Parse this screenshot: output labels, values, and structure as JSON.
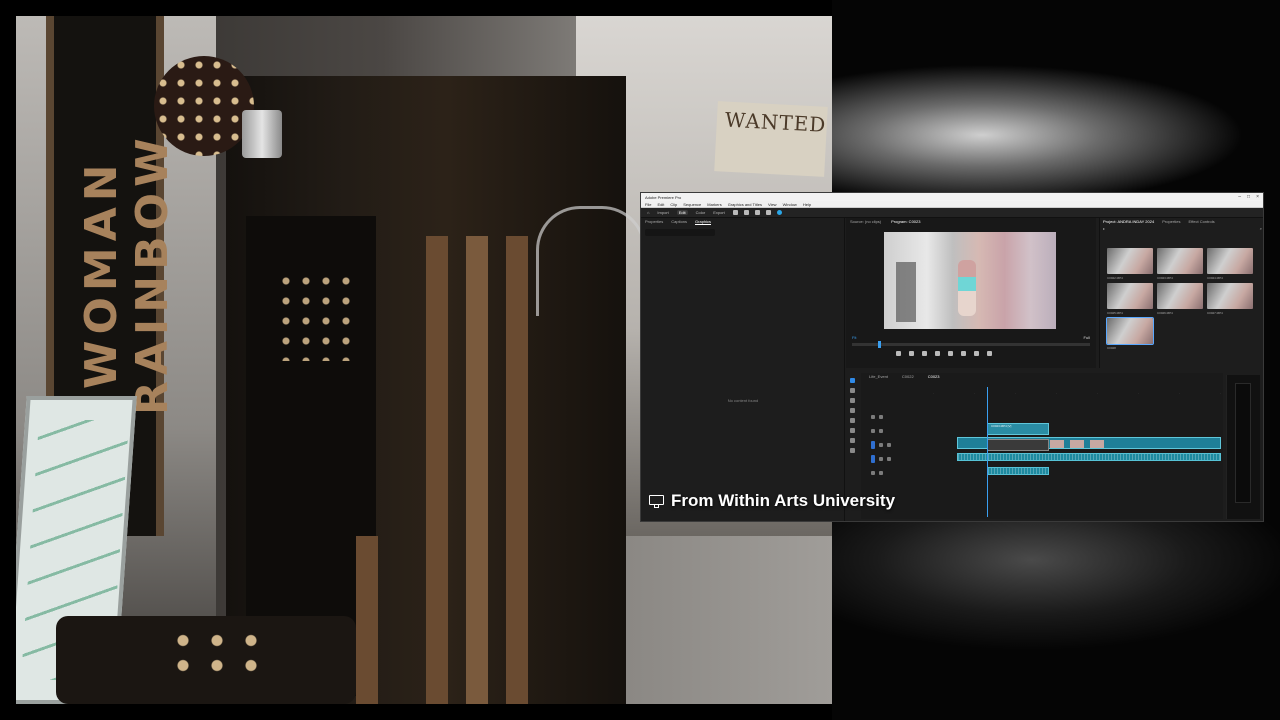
{
  "stream": {
    "caption": "From Within Arts University",
    "caption_icon": "screen-share-icon"
  },
  "background": {
    "banner_text": "WOMAN RAINBOW",
    "poster_text": "WANTED"
  },
  "premiere": {
    "window_title": "Adobe Premiere Pro",
    "menu": [
      "File",
      "Edit",
      "Clip",
      "Sequence",
      "Markers",
      "Graphics and Titles",
      "View",
      "Window",
      "Help"
    ],
    "workspaces": [
      "Import",
      "Edit",
      "Color",
      "Export"
    ],
    "active_workspace": "Edit",
    "left_panel": {
      "tabs": [
        "Properties",
        "Captions",
        "Graphics"
      ],
      "active_tab": "Graphics",
      "empty_message": "No content found"
    },
    "program_monitor": {
      "tabs": [
        "Source: (no clips)",
        "Program: C0023"
      ],
      "fit": "Fit",
      "quality": "Full"
    },
    "project_panel": {
      "tabs": [
        "Project: ANDRA INDAY 2024",
        "Properties",
        "Effect Controls",
        "Effects",
        "Search"
      ],
      "clips": [
        {
          "name": "C0022.MP4",
          "selected": false
        },
        {
          "name": "C0023.MP4",
          "selected": false
        },
        {
          "name": "C0024.MP4",
          "selected": false
        },
        {
          "name": "C0025.MP4",
          "selected": false
        },
        {
          "name": "C0026.MP4",
          "selected": false
        },
        {
          "name": "C0027.MP4",
          "selected": false
        },
        {
          "name": "C0028",
          "selected": true
        }
      ]
    },
    "timeline": {
      "tabs": [
        "Life_Event",
        "C0022",
        "C0023"
      ],
      "active_tab": "C0023",
      "clip_label": "C0023.MP4 [V]"
    }
  }
}
